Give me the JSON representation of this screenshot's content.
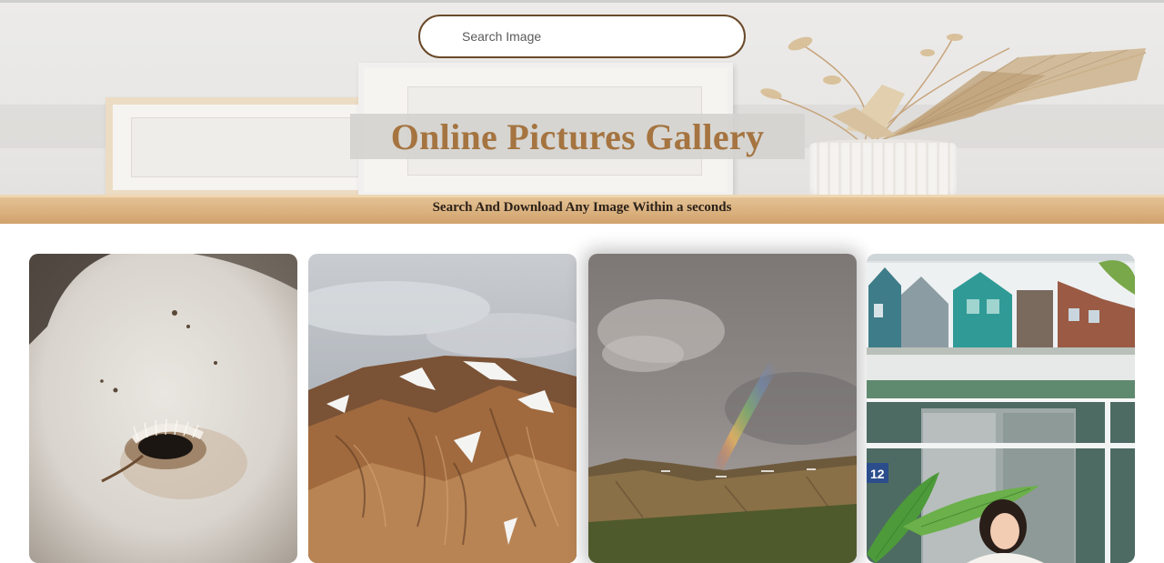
{
  "hero": {
    "search": {
      "placeholder": "Search Image",
      "value": ""
    },
    "title": "Online Pictures Gallery",
    "subtitle": "Search And Download Any Image Within a seconds"
  },
  "gallery": {
    "images": [
      {
        "subject": "horse-eye-closeup"
      },
      {
        "subject": "snowy-striped-mountains"
      },
      {
        "subject": "rainbow-over-hills"
      },
      {
        "subject": "woman-under-leaf-with-birdhouses"
      }
    ]
  },
  "colors": {
    "title_text": "#a57440",
    "search_border": "#6a4a2a",
    "subtitle_text": "#2b2119",
    "shelf": "#dcb483"
  }
}
